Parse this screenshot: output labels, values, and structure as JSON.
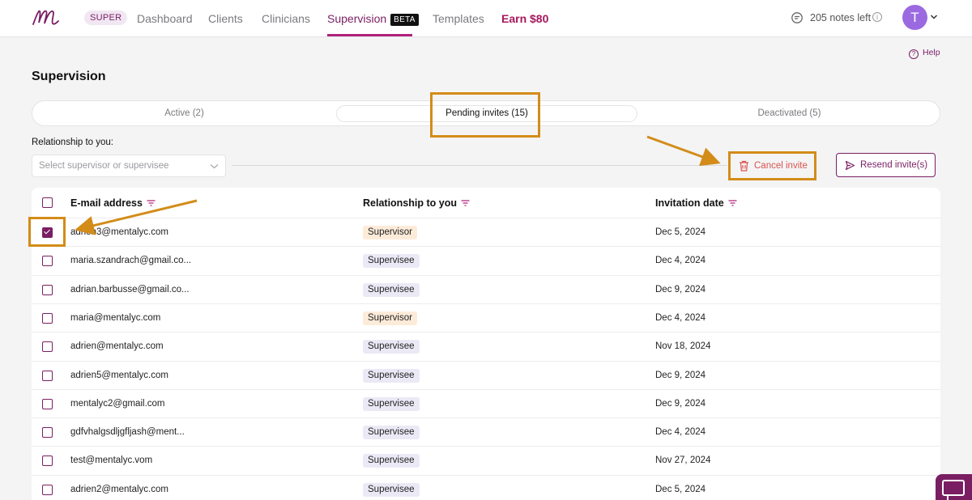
{
  "nav": {
    "plan_badge": "SUPER",
    "items": [
      {
        "label": "Dashboard"
      },
      {
        "label": "Clients"
      },
      {
        "label": "Clinicians"
      },
      {
        "label": "Supervision"
      },
      {
        "label": "Templates"
      },
      {
        "label": "Earn $80"
      }
    ],
    "beta_label": "BETA",
    "notes_left": "205 notes left",
    "avatar_initial": "T"
  },
  "help_label": "Help",
  "page_title": "Supervision",
  "tabs": [
    {
      "label": "Active (2)"
    },
    {
      "label": "Pending invites (15)"
    },
    {
      "label": "Deactivated (5)"
    }
  ],
  "filter": {
    "label": "Relationship to you:",
    "placeholder": "Select supervisor or supervisee"
  },
  "actions": {
    "cancel_label": "Cancel invite",
    "resend_label": "Resend invite(s)"
  },
  "table": {
    "headers": {
      "email": "E-mail address",
      "relationship": "Relationship to you",
      "date": "Invitation date"
    },
    "rows": [
      {
        "email": "adrien3@mentalyc.com",
        "relationship": "Supervisor",
        "date": "Dec 5, 2024",
        "checked": true
      },
      {
        "email": "maria.szandrach@gmail.co...",
        "relationship": "Supervisee",
        "date": "Dec 4, 2024",
        "checked": false
      },
      {
        "email": "adrian.barbusse@gmail.co...",
        "relationship": "Supervisee",
        "date": "Dec 9, 2024",
        "checked": false
      },
      {
        "email": "maria@mentalyc.com",
        "relationship": "Supervisor",
        "date": "Dec 4, 2024",
        "checked": false
      },
      {
        "email": "adrien@mentalyc.com",
        "relationship": "Supervisee",
        "date": "Nov 18, 2024",
        "checked": false
      },
      {
        "email": "adrien5@mentalyc.com",
        "relationship": "Supervisee",
        "date": "Dec 9, 2024",
        "checked": false
      },
      {
        "email": "mentalyc2@gmail.com",
        "relationship": "Supervisee",
        "date": "Dec 9, 2024",
        "checked": false
      },
      {
        "email": "gdfvhalgsdljgfljash@ment...",
        "relationship": "Supervisee",
        "date": "Dec 4, 2024",
        "checked": false
      },
      {
        "email": "test@mentalyc.vom",
        "relationship": "Supervisee",
        "date": "Nov 27, 2024",
        "checked": false
      },
      {
        "email": "adrien2@mentalyc.com",
        "relationship": "Supervisee",
        "date": "Dec 5, 2024",
        "checked": false
      }
    ]
  },
  "colors": {
    "brand": "#7a1e63",
    "accent": "#b0227a",
    "danger": "#d9534f",
    "supervisor_badge": "#fdebd9",
    "supervisee_badge": "#ece9f6",
    "annotation": "#d38c18"
  }
}
